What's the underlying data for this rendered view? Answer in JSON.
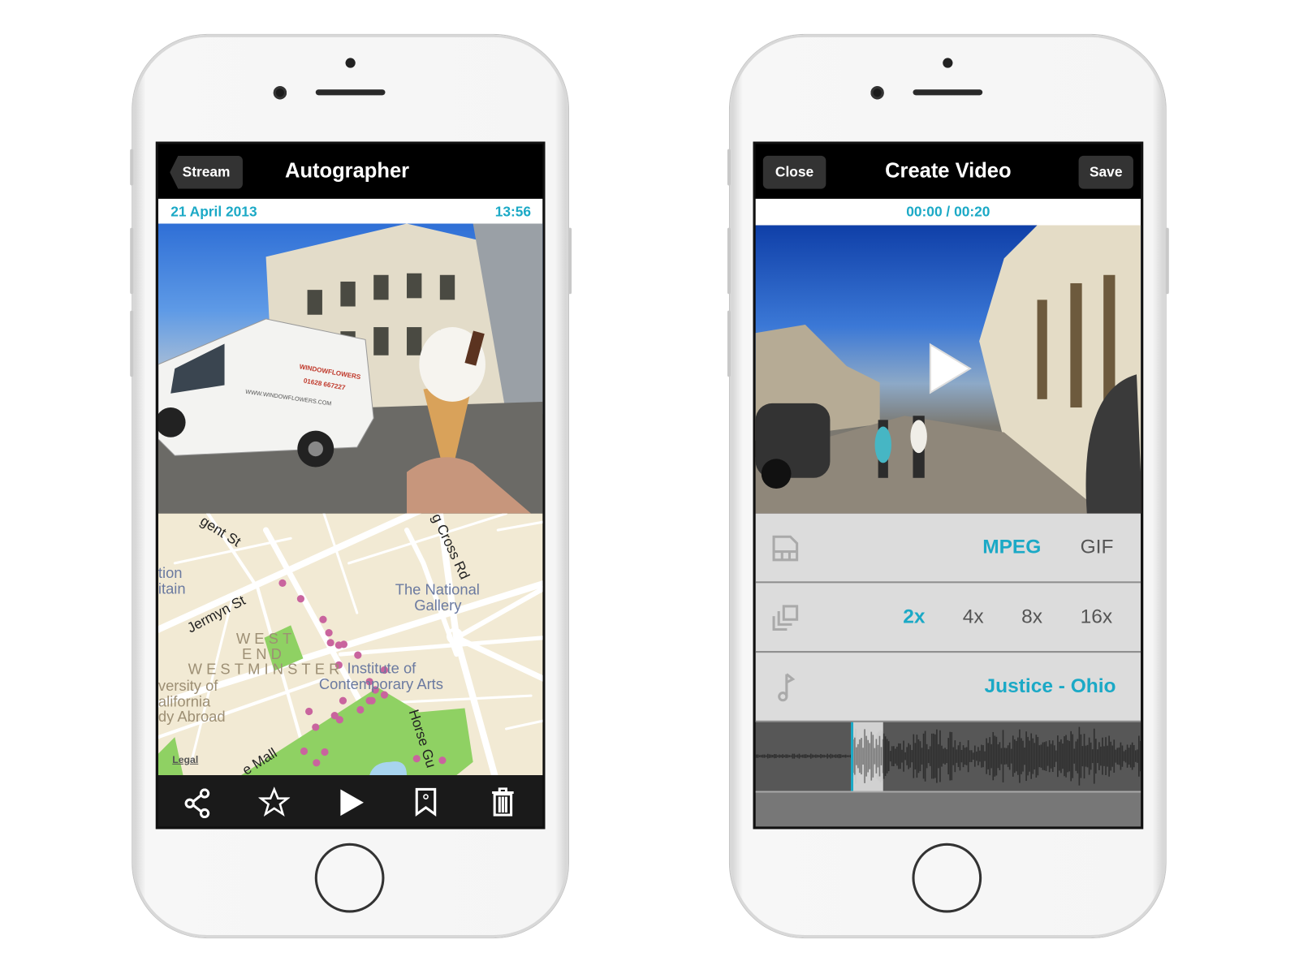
{
  "left_phone": {
    "nav": {
      "back_label": "Stream",
      "title": "Autographer"
    },
    "info": {
      "date": "21 April 2013",
      "time": "13:56"
    },
    "photo": {
      "van_text": "WINDOWFLOWERS",
      "van_phone": "01628 667227",
      "van_url": "WWW.WINDOWFLOWERS.COM"
    },
    "map": {
      "labels": {
        "regent_st": "gent St",
        "cross_rd": "g Cross Rd",
        "institution_1": "tion",
        "institution_2": "itain",
        "jermyn_st": "Jermyn St",
        "national_gallery_1": "The National",
        "national_gallery_2": "Gallery",
        "west": "WEST",
        "end": "END",
        "westminster": "WESTMINSTER",
        "ica_1": "Institute of",
        "ica_2": "Contemporary Arts",
        "uc_1": "versity of",
        "uc_2": "alifornia",
        "uc_3": "dy Abroad",
        "horse_guards": "Horse Gu",
        "mall": "e Mall",
        "legal": "Legal"
      },
      "colors": {
        "land": "#f2ead4",
        "park": "#8fd163",
        "marker": "#c9649e",
        "water": "#a8d4ee"
      }
    },
    "toolbar": [
      {
        "icon": "share-icon"
      },
      {
        "icon": "star-icon"
      },
      {
        "icon": "play-icon"
      },
      {
        "icon": "bookmark-icon"
      },
      {
        "icon": "trash-icon"
      }
    ]
  },
  "right_phone": {
    "nav": {
      "close_label": "Close",
      "title": "Create Video",
      "save_label": "Save"
    },
    "info": {
      "timecode": "00:00 / 00:20"
    },
    "format_row": {
      "icon": "film-file-icon",
      "options": [
        "MPEG",
        "GIF"
      ],
      "selected": "MPEG"
    },
    "speed_row": {
      "icon": "stack-copy-icon",
      "options": [
        "2x",
        "4x",
        "8x",
        "16x"
      ],
      "selected": "2x"
    },
    "music_row": {
      "icon": "music-note-icon",
      "track": "Justice - Ohio"
    },
    "accent_color": "#1ba9c6"
  }
}
